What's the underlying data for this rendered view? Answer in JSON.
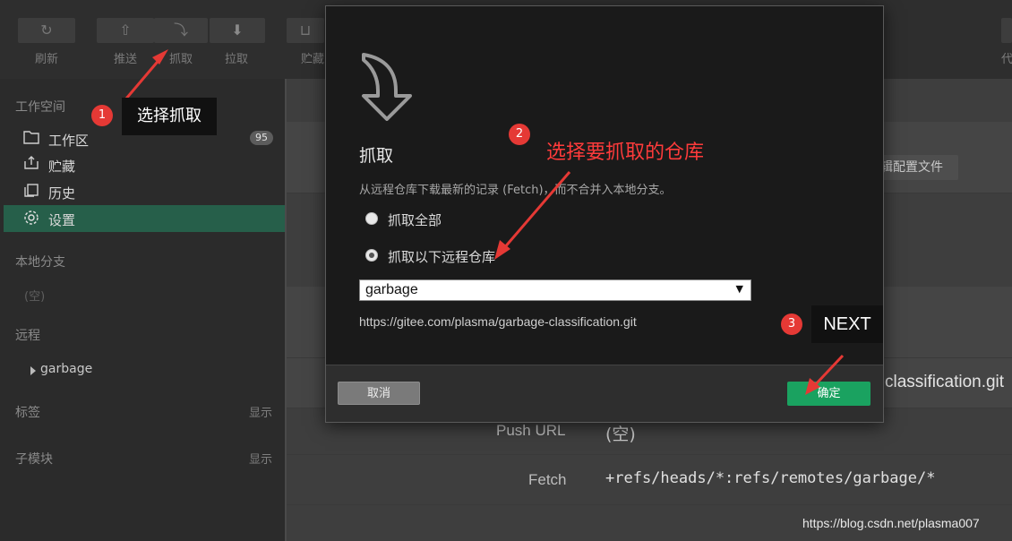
{
  "toolbar": {
    "refresh": "刷新",
    "push": "推送",
    "fetch": "抓取",
    "pull": "拉取",
    "stash": "贮藏",
    "right_partial": "代"
  },
  "sidebar": {
    "workspace_header": "工作空间",
    "items": [
      {
        "label": "工作区",
        "icon": "folder-icon"
      },
      {
        "label": "贮藏",
        "icon": "stash-icon"
      },
      {
        "label": "历史",
        "icon": "history-icon"
      },
      {
        "label": "设置",
        "icon": "gear-icon"
      }
    ],
    "workspace_count": "95",
    "local_branch_header": "本地分支",
    "local_branch_empty": "(空)",
    "remote_header": "远程",
    "remote_item": "garbage",
    "tags_header": "标签",
    "tags_show": "显示",
    "submodule_header": "子模块",
    "submodule_show": "显示"
  },
  "main": {
    "edit_config_button": "编辑配置文件",
    "url_tail": "classification.git",
    "push_url_label": "Push URL",
    "push_url_value": "(空)",
    "fetch_label": "Fetch",
    "fetch_value": "+refs/heads/*:refs/remotes/garbage/*"
  },
  "dialog": {
    "title": "抓取",
    "description": "从远程仓库下载最新的记录 (Fetch)，而不合并入本地分支。",
    "option_all": "抓取全部",
    "option_selected": "抓取以下远程仓库",
    "selected_option": "all_false",
    "remote_select_value": "garbage",
    "remote_url": "https://gitee.com/plasma/garbage-classification.git",
    "cancel_label": "取消",
    "confirm_label": "确定"
  },
  "annotations": {
    "step1_num": "1",
    "step1_text": "选择抓取",
    "step2_num": "2",
    "step2_text": "选择要抓取的仓库",
    "step3_num": "3",
    "step3_text": "NEXT"
  },
  "watermark": "https://blog.csdn.net/plasma007",
  "colors": {
    "accent_green": "#1aa260",
    "active_nav": "#265f4a",
    "annotation_red": "#e53935"
  }
}
